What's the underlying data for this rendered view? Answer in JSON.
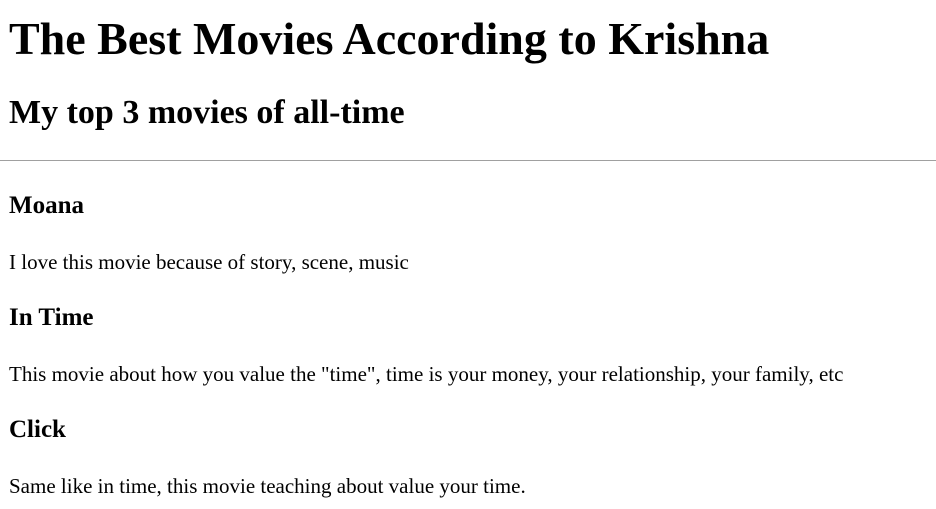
{
  "page": {
    "title": "The Best Movies According to Krishna",
    "subtitle": "My top 3 movies of all-time"
  },
  "movies": [
    {
      "title": "Moana",
      "description": "I love this movie because of story, scene, music"
    },
    {
      "title": "In Time",
      "description": "This movie about how you value the \"time\", time is your money, your relationship, your family, etc"
    },
    {
      "title": "Click",
      "description": "Same like in time, this movie teaching about value your time."
    }
  ]
}
